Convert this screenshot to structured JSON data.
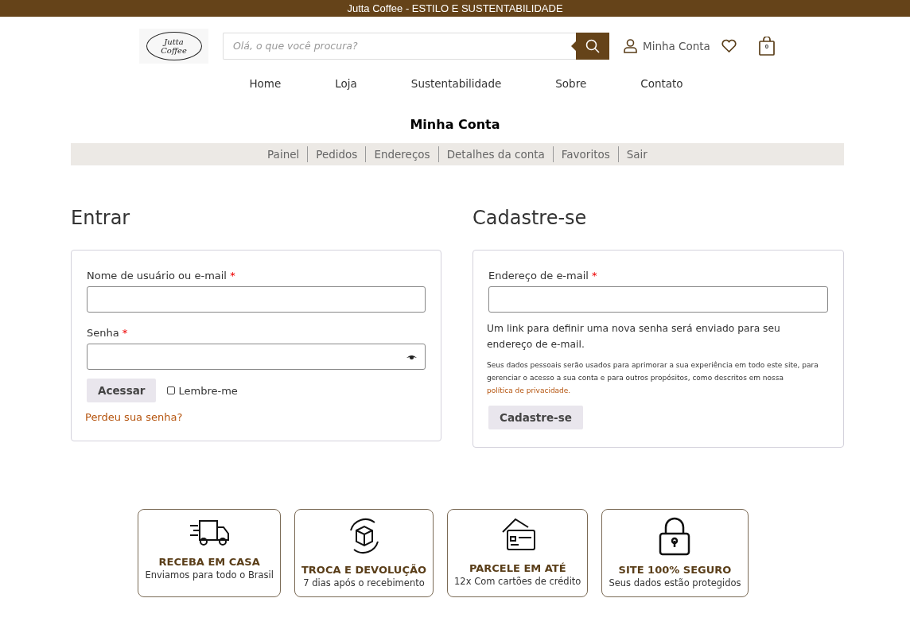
{
  "announcement": "Jutta Coffee - ESTILO E SUSTENTABILIDADE",
  "logo": {
    "line_1": "Jutta",
    "line_2": "Coffee"
  },
  "search": {
    "placeholder": "Olá, o que você procura?"
  },
  "account_link": "Minha Conta",
  "cart": {
    "count": "0"
  },
  "nav": [
    "Home",
    "Loja",
    "Sustentabilidade",
    "Sobre",
    "Contato"
  ],
  "page_title": "Minha Conta",
  "account_tabs": [
    "Painel",
    "Pedidos",
    "Endereços",
    "Detalhes da conta",
    "Favoritos",
    "Sair"
  ],
  "login": {
    "heading": "Entrar",
    "fields": [
      {
        "label": "Nome de usuário ou e-mail",
        "required_mark": "*",
        "kind": "text"
      },
      {
        "label": "Senha",
        "required_mark": "*",
        "kind": "password"
      }
    ],
    "button": "Acessar",
    "remember": {
      "label": "Lembre-me",
      "checked": false
    },
    "lost_password": "Perdeu sua senha?"
  },
  "register": {
    "heading": "Cadastre-se",
    "fields": [
      {
        "label": "Endereço de e-mail",
        "required_mark": "*",
        "kind": "text"
      }
    ],
    "info": "Um link para definir uma nova senha será enviado para seu endereço de e-mail.",
    "privacy_text": "Seus dados pessoais serão usados para aprimorar a sua experiência em todo este site, para gerenciar o acesso a sua conta e para outros propósitos, como descritos em nossa",
    "privacy_link": "política de privacidade.",
    "button": "Cadastre-se"
  },
  "features": [
    {
      "kind": "truck",
      "title": "RECEBA EM CASA",
      "subtitle": "Enviamos para todo o Brasil"
    },
    {
      "kind": "return",
      "title": "TROCA E DEVOLUÇÃO",
      "subtitle": "7 dias após o recebimento"
    },
    {
      "kind": "card",
      "title": "PARCELE EM ATÉ",
      "subtitle": "12x Com cartões de crédito"
    },
    {
      "kind": "lock",
      "title": "SITE 100% SEGURO",
      "subtitle": "Seus dados estão protegidos"
    }
  ]
}
